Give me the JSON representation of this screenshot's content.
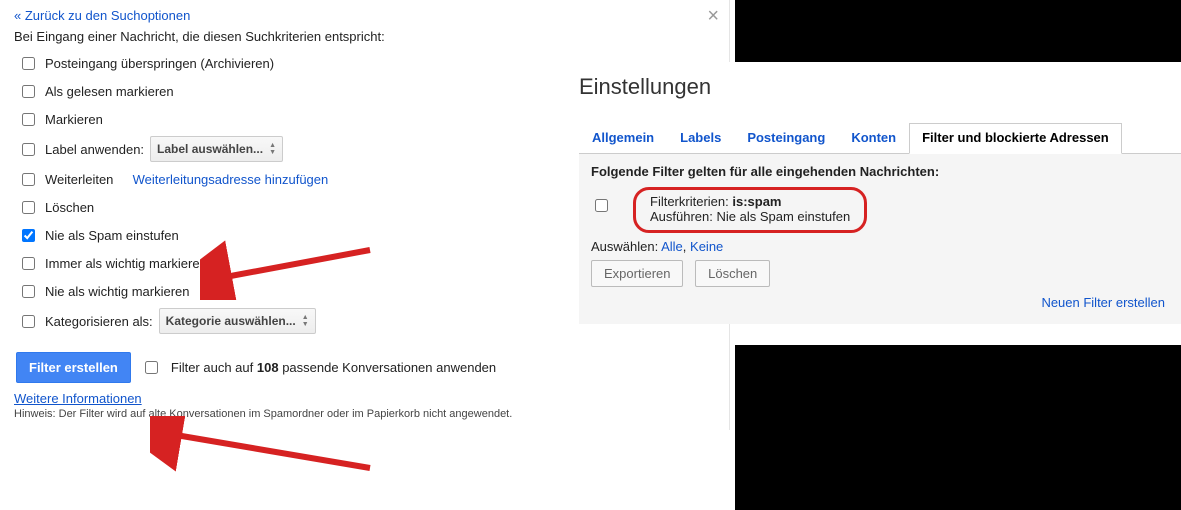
{
  "leftPanel": {
    "backLink": "« Zurück zu den Suchoptionen",
    "intro": "Bei Eingang einer Nachricht, die diesen Suchkriterien entspricht:",
    "options": {
      "skipInbox": "Posteingang überspringen (Archivieren)",
      "markRead": "Als gelesen markieren",
      "star": "Markieren",
      "applyLabel": "Label anwenden:",
      "labelSelect": "Label auswählen...",
      "forward": "Weiterleiten",
      "addForwardAddr": "Weiterleitungsadresse hinzufügen",
      "delete": "Löschen",
      "neverSpam": "Nie als Spam einstufen",
      "alwaysImportant": "Immer als wichtig markieren",
      "neverImportant": "Nie als wichtig markieren",
      "categorize": "Kategorisieren als:",
      "categorySelect": "Kategorie auswählen..."
    },
    "createBtn": "Filter erstellen",
    "alsoApplyPrefix": "Filter auch auf ",
    "alsoApplyCount": "108",
    "alsoApplySuffix": " passende Konversationen anwenden",
    "moreInfo": "Weitere Informationen",
    "hint": "Hinweis: Der Filter wird auf alte Konversationen im Spamordner oder im Papierkorb nicht angewendet."
  },
  "rightPanel": {
    "title": "Einstellungen",
    "tabs": {
      "general": "Allgemein",
      "labels": "Labels",
      "inbox": "Posteingang",
      "accounts": "Konten",
      "filters": "Filter und blockierte Adressen"
    },
    "filtersHeading": "Folgende Filter gelten für alle eingehenden Nachrichten:",
    "filterCriteriaLabel": "Filterkriterien: ",
    "filterCriteriaValue": "is:spam",
    "filterActionLabel": "Ausführen: ",
    "filterActionValue": "Nie als Spam einstufen",
    "selectLabel": "Auswählen: ",
    "selectAll": "Alle",
    "selectNone": "Keine",
    "exportBtn": "Exportieren",
    "deleteBtn": "Löschen",
    "newFilter": "Neuen Filter erstellen"
  }
}
